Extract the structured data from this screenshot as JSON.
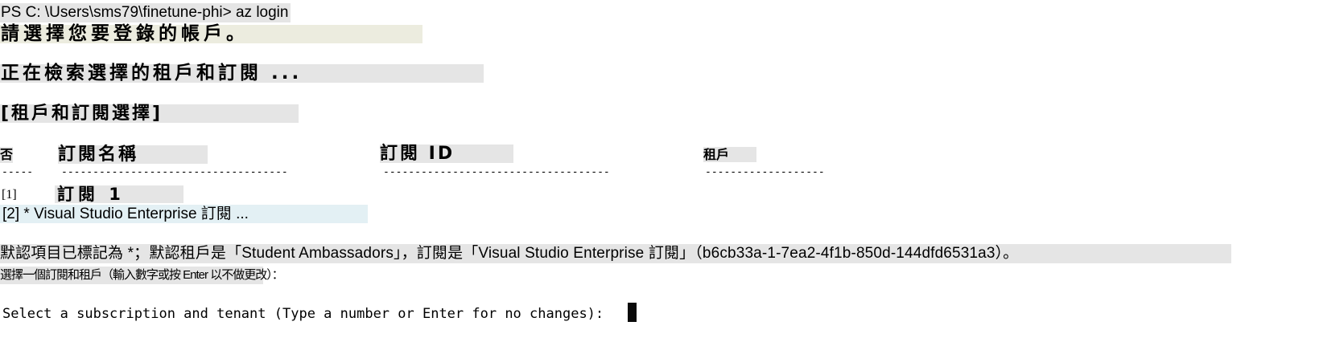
{
  "terminal": {
    "command_line": "PS C: \\Users\\sms79\\finetune-phi> az login",
    "choose_account": "請選擇您要登錄的帳戶。",
    "retrieving": "正在檢索選擇的租戶和訂閱 ...",
    "section_title": "[租戶和訂閱選擇]",
    "table": {
      "headers": {
        "no": "否",
        "subscription_name": "訂閱名稱",
        "subscription_id": "訂閱 ID",
        "tenant": "租戶"
      },
      "separators": {
        "no": "-----",
        "subscription_name": "------------------------------------",
        "subscription_id": "------------------------------------",
        "tenant": "-------------------"
      },
      "rows": [
        {
          "no": "[1]",
          "subscription_name": "訂閱 1"
        },
        {
          "text": "[2] * Visual Studio Enterprise 訂閱 ..."
        }
      ]
    },
    "default_note": "默認項目已標記為 *；默認租戶是「Student Ambassadors」，訂閱是「Visual Studio Enterprise 訂閱」（b6cb33a-1-7ea2-4f1b-850d-144dfd6531a3）。",
    "select_prompt_zh": "選擇一個訂閱和租戶（輸入數字或按 Enter 以不做更改）：",
    "select_prompt_en": "Select a subscription and tenant (Type a number or Enter for no changes): "
  },
  "colors": {
    "background": "#ffffff",
    "text": "#000000",
    "highlight": "#e5e5e5",
    "cursor": "#0a0a0a"
  }
}
